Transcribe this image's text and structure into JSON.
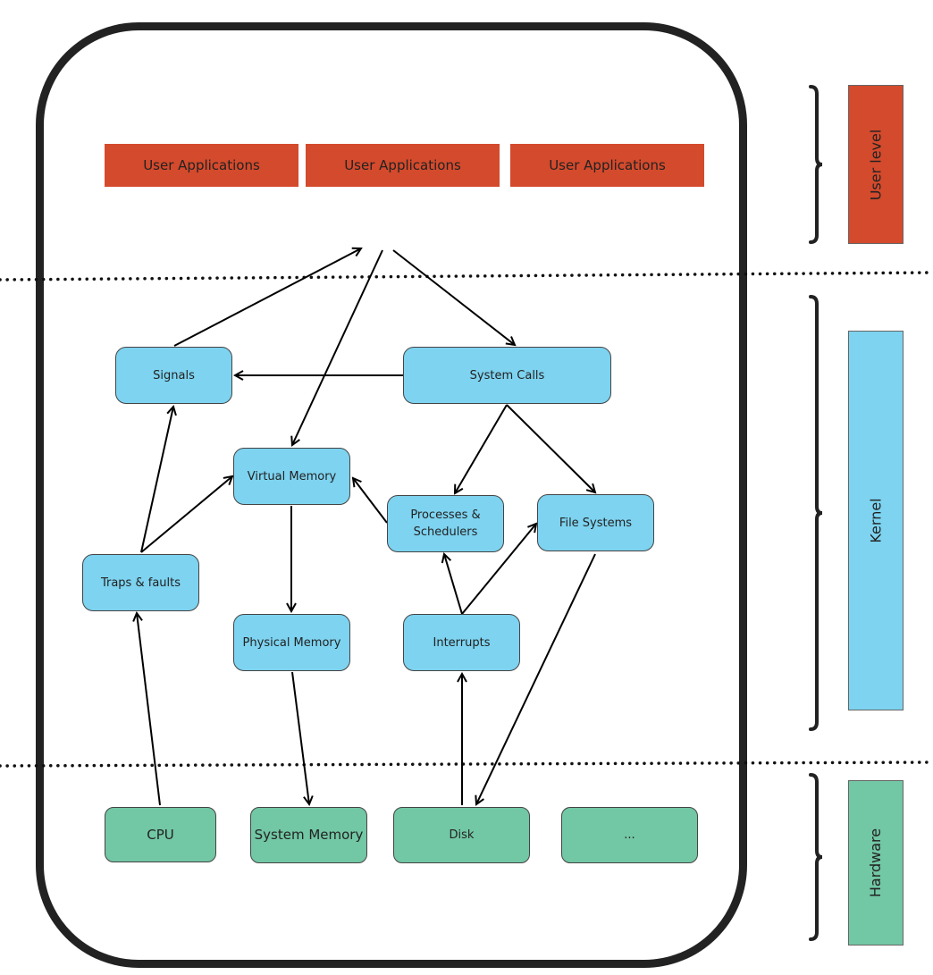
{
  "colors": {
    "user": "#d44a2c",
    "kernel": "#7dd3f0",
    "hardware": "#72c7a5"
  },
  "user_apps": [
    "User Applications",
    "User Applications",
    "User Applications"
  ],
  "kernel": {
    "signals": "Signals",
    "system_calls": "System Calls",
    "virtual_memory": "Virtual Memory",
    "processes": "Processes & Schedulers",
    "file_systems": "File Systems",
    "traps": "Traps & faults",
    "physical_memory": "Physical Memory",
    "interrupts": "Interrupts"
  },
  "hardware": [
    "CPU",
    "System Memory",
    "Disk",
    "..."
  ],
  "layers": {
    "user": "User level",
    "kernel": "Kernel",
    "hardware": "Hardware"
  }
}
